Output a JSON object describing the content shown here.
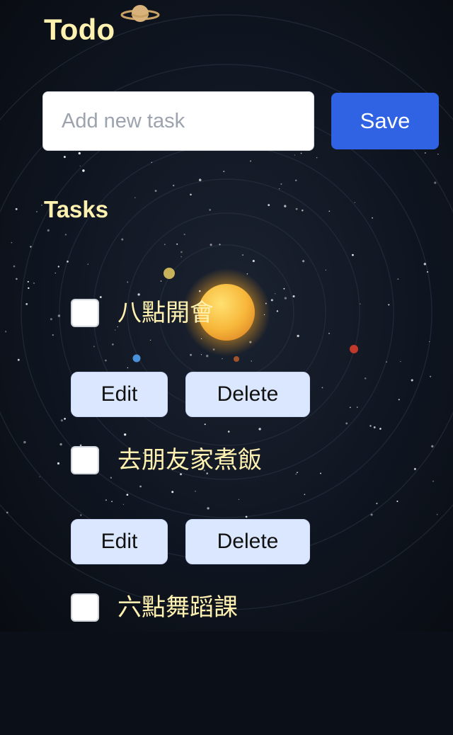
{
  "app": {
    "title": "Todo",
    "icon": "planet-icon"
  },
  "new_task": {
    "value": "",
    "placeholder": "Add new task",
    "save_label": "Save"
  },
  "tasks_section": {
    "heading": "Tasks",
    "edit_label": "Edit",
    "delete_label": "Delete",
    "items": [
      {
        "text": "八點開會",
        "completed": false
      },
      {
        "text": "去朋友家煮飯",
        "completed": false
      },
      {
        "text": "六點舞蹈課",
        "completed": false
      }
    ]
  },
  "theme": {
    "background": "#0b1018",
    "accent": "#2f63e4",
    "title_color": "#fff1b0",
    "secondary_button": "#dbe7ff"
  }
}
